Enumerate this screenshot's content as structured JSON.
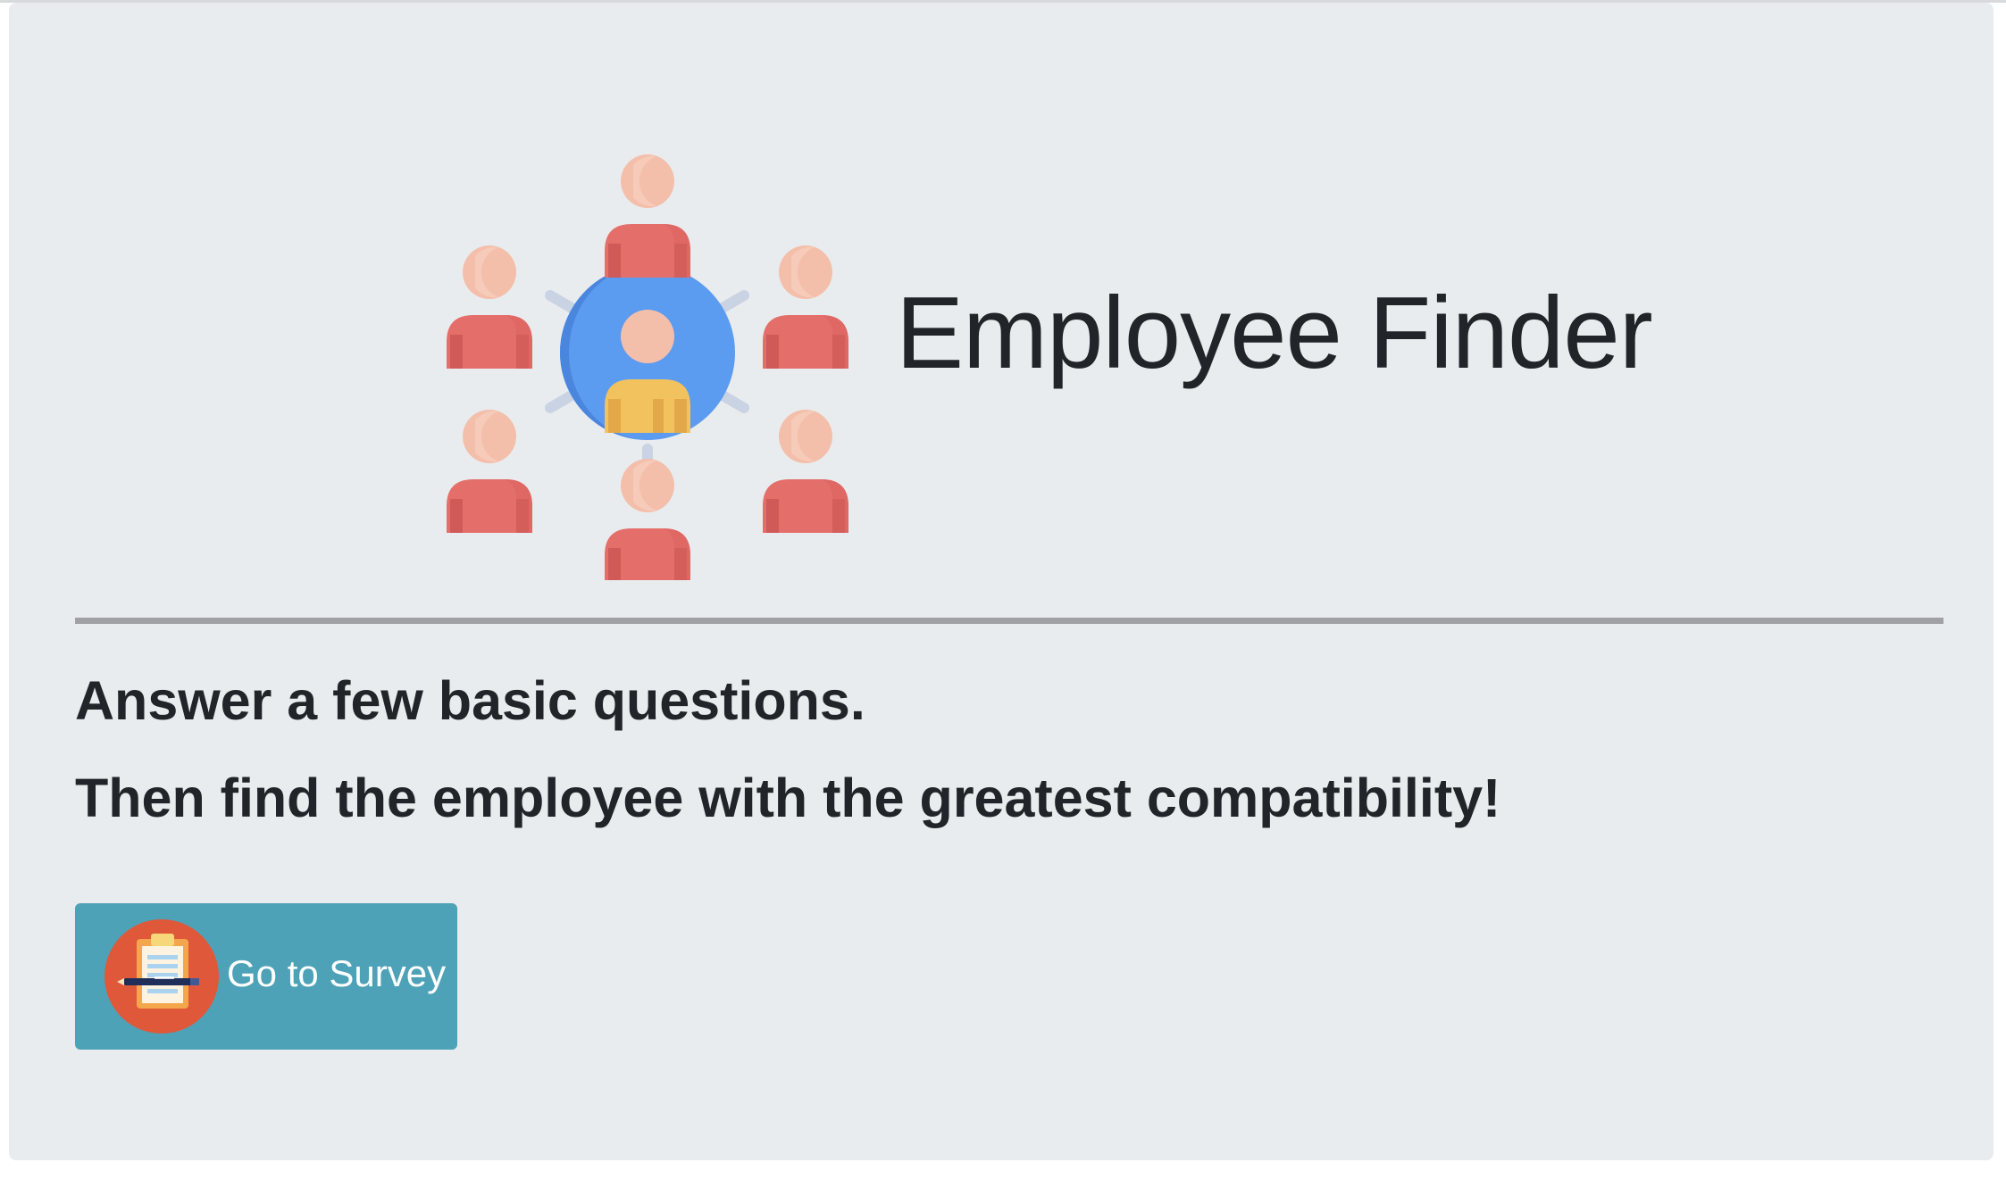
{
  "header": {
    "title": "Employee Finder",
    "logo_icon": "team-network-icon"
  },
  "intro": {
    "line1": "Answer a few basic questions.",
    "line2": "Then find the employee with the greatest compatibility!"
  },
  "survey_button": {
    "label": "Go to Survey",
    "icon": "clipboard-pen-icon"
  },
  "colors": {
    "background": "#e9ecef",
    "text": "#212529",
    "button": "#4ea2b7",
    "person_body": "#e46f6a",
    "person_head": "#f4bfaa",
    "hub_circle": "#5b9bf0",
    "hub_person": "#f2c25e"
  }
}
